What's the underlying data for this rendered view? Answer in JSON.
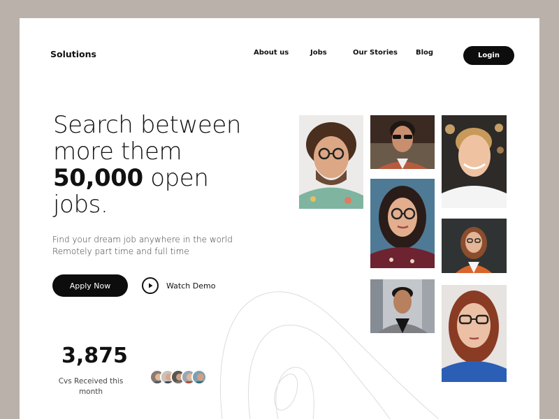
{
  "brand": {
    "name": "Solutions"
  },
  "nav": {
    "links": [
      "About us",
      "Jobs",
      "Our Stories",
      "Blog"
    ],
    "login_label": "Login"
  },
  "hero": {
    "line1": "Search between",
    "line2": "more them",
    "line3_bold": "50,000",
    "line3_rest": " open",
    "line4": "jobs.",
    "sub1": "Find your dream job anywhere in the world",
    "sub2": "Remotely part time and full time"
  },
  "actions": {
    "apply_label": "Apply Now",
    "watch_label": "Watch Demo"
  },
  "stats": {
    "value": "3,875",
    "label": "Cvs Received this month"
  },
  "colors": {
    "background": "#b9b1aa",
    "card": "#ffffff",
    "primary": "#0d0d0d"
  }
}
